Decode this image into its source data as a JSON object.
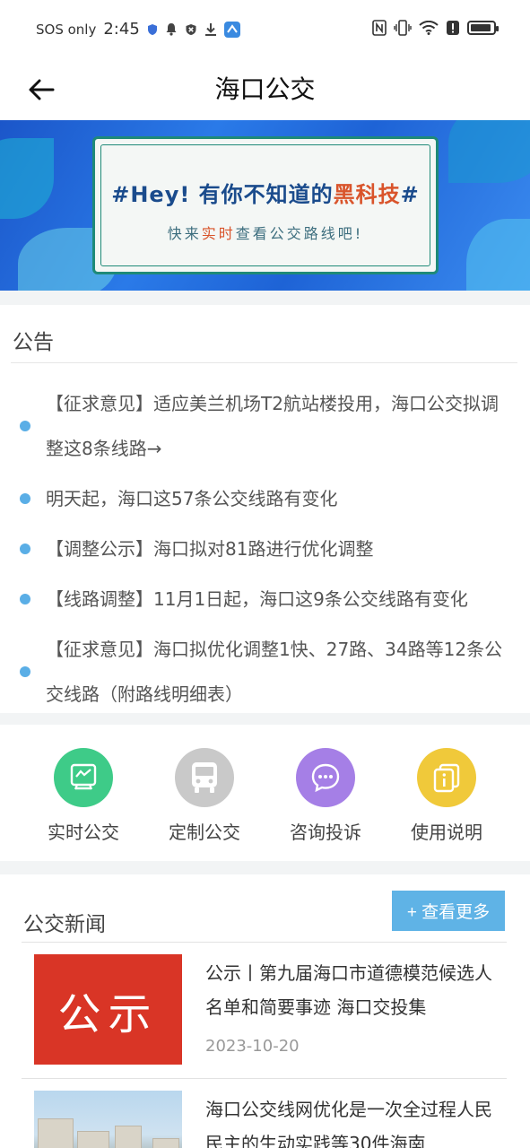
{
  "status": {
    "carrier": "SOS only",
    "time": "2:45",
    "battery_level": 0.9
  },
  "header": {
    "title": "海口公交"
  },
  "banner": {
    "headline_prefix": "#Hey! 有你不知道的",
    "headline_highlight": "黑科技",
    "headline_suffix": "#",
    "sub_prefix": "快来",
    "sub_highlight": "实时",
    "sub_suffix": "查看公交路线吧!"
  },
  "notice": {
    "title": "公告",
    "items": [
      "【征求意见】适应美兰机场T2航站楼投用，海口公交拟调整这8条线路→",
      "明天起，海口这57条公交线路有变化",
      "【调整公示】海口拟对81路进行优化调整",
      "【线路调整】11月1日起，海口这9条公交线路有变化",
      "【征求意见】海口拟优化调整1快、27路、34路等12条公交线路（附路线明细表）"
    ]
  },
  "quick_menu": [
    {
      "label": "实时公交",
      "color": "#3ecb88",
      "icon": "realtime-bus-icon"
    },
    {
      "label": "定制公交",
      "color": "#c9c9c9",
      "icon": "bus-icon"
    },
    {
      "label": "咨询投诉",
      "color": "#a57fe6",
      "icon": "chat-icon"
    },
    {
      "label": "使用说明",
      "color": "#f0c93a",
      "icon": "info-cards-icon"
    }
  ],
  "news": {
    "title": "公交新闻",
    "more_label": "+ 查看更多",
    "items": [
      {
        "thumb_text": "公示",
        "text": "公示丨第九届海口市道德模范候选人名单和简要事迹 海口交投集",
        "date": "2023-10-20"
      },
      {
        "text": "海口公交线网优化是一次全过程人民民主的生动实践等30件海南"
      }
    ]
  },
  "colors": {
    "accent": "#5fb3e6",
    "dot": "#5aaee6",
    "highlight": "#d9542b"
  }
}
